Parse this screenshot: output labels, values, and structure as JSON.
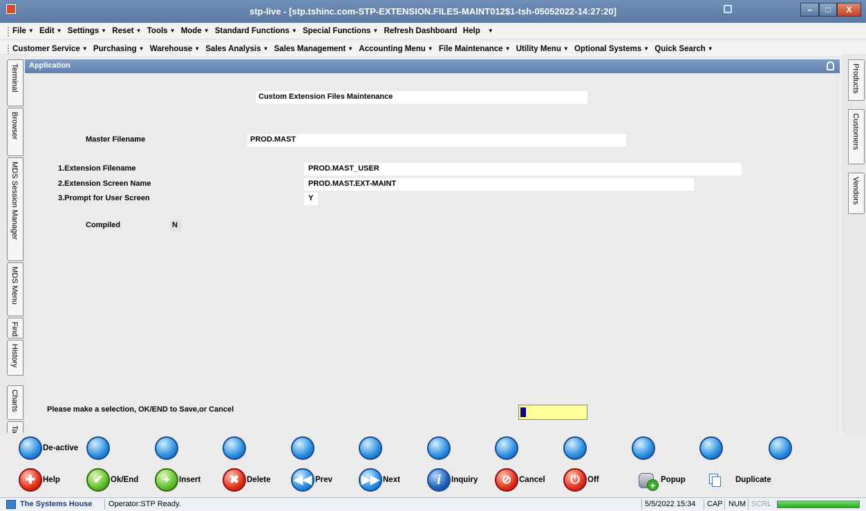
{
  "window": {
    "title": "stp-live - [stp.tshinc.com-STP-EXTENSION.FILES-MAINT012$1-tsh-05052022-14:27:20]",
    "min": "–",
    "max": "□",
    "close": "X"
  },
  "menu1": [
    "File",
    "Edit",
    "Settings",
    "Reset",
    "Tools",
    "Mode",
    "Standard Functions",
    "Special Functions",
    "Refresh Dashboard",
    "Help"
  ],
  "menu2": [
    "Customer Service",
    "Purchasing",
    "Warehouse",
    "Sales Analysis",
    "Sales Management",
    "Accounting Menu",
    "File Maintenance",
    "Utility Menu",
    "Optional Systems",
    "Quick Search"
  ],
  "left_tabs": [
    "Terminal",
    "Browser",
    "MDS Session Manager",
    "MDS Menu",
    "Find",
    "History",
    "Charts",
    "Ta"
  ],
  "right_tabs": [
    "Products",
    "Customers",
    "Vendors"
  ],
  "app_header": "Application",
  "form": {
    "heading": "Custom Extension Files Maintenance",
    "master_label": "Master Filename",
    "master_value": "PROD.MAST",
    "ext_filename_label": "1.Extension Filename",
    "ext_filename_value": "PROD.MAST_USER",
    "ext_screen_label": "2.Extension Screen Name",
    "ext_screen_value": "PROD.MAST.EXT-MAINT",
    "prompt_label": "3.Prompt for User Screen",
    "prompt_value": "Y",
    "compiled_label": "Compiled",
    "compiled_value": "N",
    "message": "Please make a selection, OK/END to Save,or Cancel"
  },
  "buttons_row1": {
    "deactive": "De-active"
  },
  "buttons_row2": {
    "help": "Help",
    "ok": "Ok/End",
    "insert": "Insert",
    "delete": "Delete",
    "prev": "Prev",
    "next": "Next",
    "inquiry": "Inquiry",
    "cancel": "Cancel",
    "off": "Off",
    "popup": "Popup",
    "duplicate": "Duplicate"
  },
  "status": {
    "company": "The Systems House",
    "operator": "Operator:STP Ready.",
    "datetime": "5/5/2022 15:34",
    "cap": "CAP",
    "num": "NUM",
    "scrl": "SCRL"
  },
  "colors": {
    "title_bar": "#5b79a3",
    "input_highlight": "#ffff99"
  }
}
